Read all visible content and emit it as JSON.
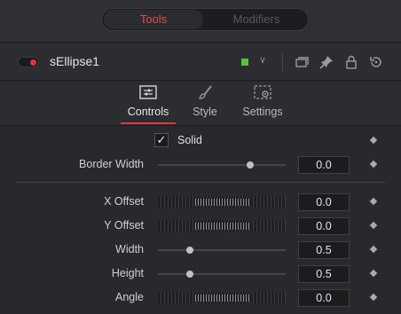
{
  "top_tabs": {
    "tools": "Tools",
    "modifiers": "Modifiers"
  },
  "tool": {
    "name": "sEllipse1",
    "enabled": true,
    "color": "#5cc13a"
  },
  "page_tabs": [
    {
      "label": "Controls",
      "icon": "sliders-icon",
      "active": true
    },
    {
      "label": "Style",
      "icon": "brush-icon",
      "active": false
    },
    {
      "label": "Settings",
      "icon": "settings-icon",
      "active": false
    }
  ],
  "controls": {
    "solid": {
      "label": "Solid",
      "checked": true
    },
    "border_width": {
      "label": "Border Width",
      "value": "0.0",
      "slider": 0.72
    },
    "x_offset": {
      "label": "X Offset",
      "value": "0.0"
    },
    "y_offset": {
      "label": "Y Offset",
      "value": "0.0"
    },
    "width": {
      "label": "Width",
      "value": "0.5",
      "slider": 0.25
    },
    "height": {
      "label": "Height",
      "value": "0.5",
      "slider": 0.25
    },
    "angle": {
      "label": "Angle",
      "value": "0.0"
    }
  },
  "colors": {
    "accent": "#d83b3f",
    "tools_tab": "#e8464b",
    "enabled_dot": "#e8303a"
  }
}
